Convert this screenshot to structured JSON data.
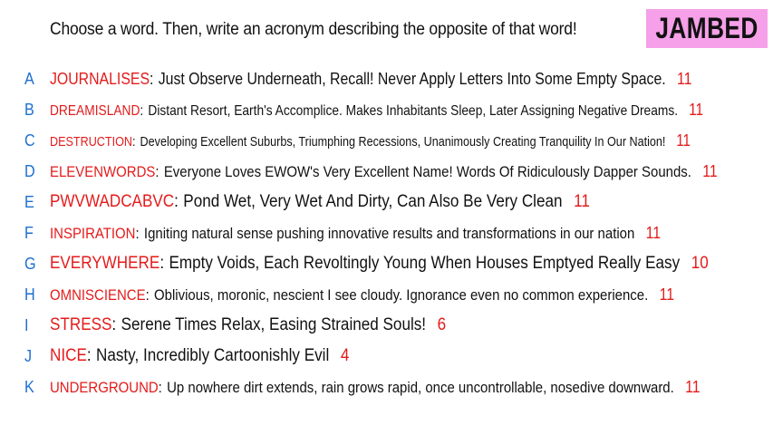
{
  "header": {
    "prompt": "Choose a word. Then, write an acronym describing the opposite of that word!",
    "brand": "JAMBED"
  },
  "colors": {
    "letter": "#1e6fd0",
    "word": "#e41b1b",
    "brand_bg": "#f5a0e8"
  },
  "entries": [
    {
      "letter": "A",
      "word": "JOURNALISES",
      "phrase": "Just Observe Underneath, Recall! Never Apply Letters Into Some Empty Space.",
      "count": "11"
    },
    {
      "letter": "B",
      "word": "DREAMISLAND",
      "phrase": "Distant Resort, Earth's Accomplice. Makes Inhabitants Sleep, Later Assigning Negative Dreams.",
      "count": "11"
    },
    {
      "letter": "C",
      "word": "DESTRUCTION",
      "phrase": "Developing Excellent Suburbs, Triumphing Recessions, Unanimously Creating Tranquility In Our Nation!",
      "count": "11"
    },
    {
      "letter": "D",
      "word": "ELEVENWORDS",
      "phrase": "Everyone Loves EWOW's Very Excellent Name! Words Of Ridiculously Dapper Sounds.",
      "count": "11"
    },
    {
      "letter": "E",
      "word": "PWVWADCABVC",
      "phrase": "Pond Wet, Very Wet And Dirty, Can Also Be Very Clean",
      "count": "11"
    },
    {
      "letter": "F",
      "word": "INSPIRATION",
      "phrase": "Igniting natural sense pushing innovative results and transformations in our nation",
      "count": "11"
    },
    {
      "letter": "G",
      "word": "EVERYWHERE",
      "phrase": "Empty Voids, Each Revoltingly Young When Houses Emptyed Really Easy",
      "count": "10"
    },
    {
      "letter": "H",
      "word": "OMNISCIENCE",
      "phrase": "Oblivious, moronic, nescient I see cloudy. Ignorance even no common experience.",
      "count": "11"
    },
    {
      "letter": "I",
      "word": "STRESS",
      "phrase": "Serene Times Relax, Easing Strained Souls!",
      "count": "6"
    },
    {
      "letter": "J",
      "word": "NICE",
      "phrase": "Nasty, Incredibly Cartoonishly Evil",
      "count": "4"
    },
    {
      "letter": "K",
      "word": "UNDERGROUND",
      "phrase": "Up nowhere dirt extends, rain grows rapid, once uncontrollable, nosedive downward.",
      "count": "11"
    }
  ]
}
